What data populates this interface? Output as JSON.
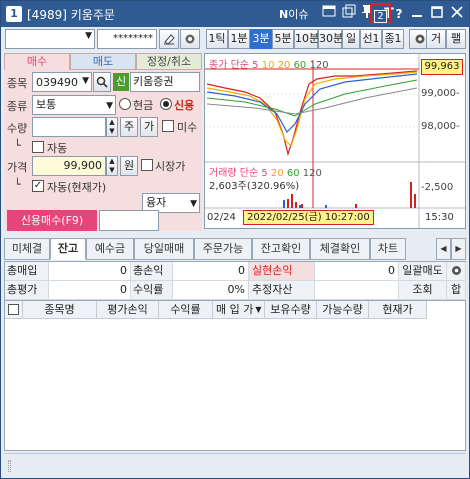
{
  "title": {
    "num": "1",
    "code": "[4989]",
    "name": "키움주문",
    "n_label": "N",
    "n_suffix": "이슈",
    "help_num": "2",
    "q": "?"
  },
  "top": {
    "account_value": "",
    "password_mask": "********"
  },
  "timeframes": [
    "1틱",
    "1분",
    "3분",
    "5분",
    "10분",
    "30분",
    "일",
    "선1",
    "종1"
  ],
  "timeframe_selected": "3분",
  "order_tabs": {
    "buy": "매수",
    "sell": "매도",
    "modify": "정정/취소"
  },
  "order": {
    "code_label": "종목",
    "code_value": "039490",
    "stock_name": "키움증권",
    "credit_badge": "신",
    "kind_label": "종류",
    "kind_value": "보통",
    "cash_label": "현금",
    "credit_label": "신용",
    "qty_label": "수량",
    "qty_value": "",
    "main_btn": "주",
    "ga_btn": "가",
    "misu_label": "미수",
    "auto1_label": "자동",
    "price_label": "가격",
    "price_value": "99,900",
    "won_btn": "원",
    "market_label": "시장가",
    "auto2_label": "자동(현재가)",
    "loan_value": "융자",
    "submit_label": "신용매수(F9)"
  },
  "chart": {
    "top_label": "종가 단순 5",
    "ma_labels": [
      "10",
      "20",
      "60",
      "120"
    ],
    "price_tag": "99,963",
    "y_labels": [
      "99,000-",
      "98,000-"
    ],
    "vol_label": "거래량 단순 5",
    "vol_ma": [
      "20",
      "60",
      "120"
    ],
    "vol_value": "2,603주(320.96%)",
    "vol_y": "-2,500",
    "date_left": "02/24",
    "date_sel": "2022/02/25(금) 10:27:00",
    "time_right": "15:30"
  },
  "chart_extra_buttons": {
    "geo": "거",
    "pae": "팰"
  },
  "bottom_tabs": [
    "미체결",
    "잔고",
    "예수금",
    "당일매매",
    "주문가능",
    "잔고확인",
    "체결확인",
    "차트"
  ],
  "bottom_tab_selected": "잔고",
  "summary": {
    "row1": {
      "a_label": "총매입",
      "a_val": "0",
      "b_label": "총손익",
      "b_val": "0",
      "c_label": "실현손익",
      "c_val": "0",
      "d_label": "일괄매도"
    },
    "row2": {
      "a_label": "총평가",
      "a_val": "0",
      "b_label": "수익률",
      "b_val": "0%",
      "c_label": "추정자산",
      "c_val": "",
      "d_label": "조회",
      "e_label": "합"
    }
  },
  "grid_headers": [
    "종목명",
    "평가손익",
    "수익률",
    "매 입 가",
    "보유수량",
    "가능수량",
    "현재가"
  ],
  "colors": {
    "title": "#2f5b92",
    "buy_pink": "#e8437a",
    "price_red": "#d42020",
    "sel_blue": "#2f6fd0"
  }
}
